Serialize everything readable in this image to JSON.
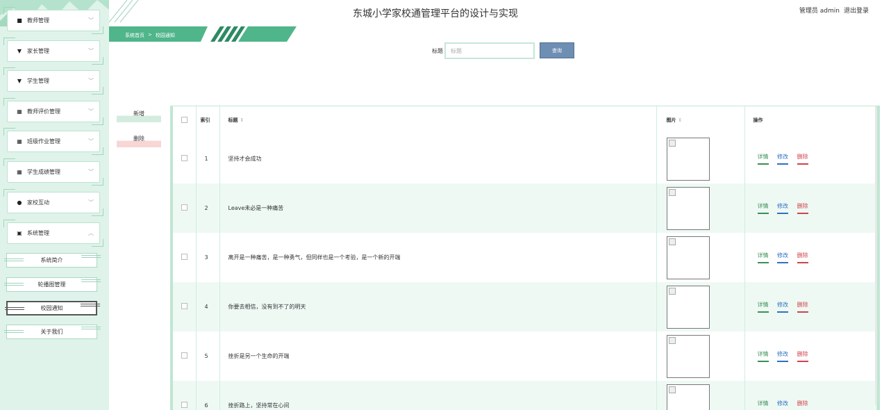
{
  "app": {
    "title": "东城小学家校通管理平台的设计与实现"
  },
  "user": {
    "label": "管理员 admin",
    "logout": "退出登录"
  },
  "breadcrumb": {
    "home": "系统首页",
    "sep": ">",
    "current": "校园通知"
  },
  "sidebar": {
    "groups": [
      {
        "label": "教师管理",
        "icon": "teacher-icon",
        "expanded": false
      },
      {
        "label": "家长管理",
        "icon": "parent-icon",
        "expanded": false
      },
      {
        "label": "学生管理",
        "icon": "student-icon",
        "expanded": false
      },
      {
        "label": "教师评价管理",
        "icon": "grid-icon",
        "expanded": false
      },
      {
        "label": "班级作业管理",
        "icon": "grid-icon",
        "expanded": false
      },
      {
        "label": "学生成绩管理",
        "icon": "grid-icon",
        "expanded": false
      },
      {
        "label": "家校互动",
        "icon": "pin-icon",
        "expanded": false
      },
      {
        "label": "系统管理",
        "icon": "building-icon",
        "expanded": true
      }
    ],
    "submenu": [
      {
        "label": "系统简介",
        "active": false
      },
      {
        "label": "轮播图管理",
        "active": false
      },
      {
        "label": "校园通知",
        "active": true
      },
      {
        "label": "关于我们",
        "active": false
      }
    ]
  },
  "search": {
    "label": "标题",
    "placeholder": "标题",
    "value": "",
    "button": "查询"
  },
  "actions": {
    "add": "新增",
    "delete": "删除"
  },
  "table": {
    "columns": {
      "index": "索引",
      "title": "标题",
      "image": "图片",
      "ops": "操作"
    },
    "sort_icon": "⇕",
    "rows": [
      {
        "index": "1",
        "title": "坚持才会成功"
      },
      {
        "index": "2",
        "title": "Leave未必是一种痛苦"
      },
      {
        "index": "3",
        "title": "离开是一种痛苦，是一种勇气，但同样也是一个考验，是一个新的开端"
      },
      {
        "index": "4",
        "title": "你要去相信，没有到不了的明天"
      },
      {
        "index": "5",
        "title": "挫折是另一个生命的开端"
      },
      {
        "index": "6",
        "title": "挫折路上，坚持常在心间"
      }
    ],
    "row_actions": {
      "detail": "详情",
      "edit": "修改",
      "delete": "删除"
    }
  },
  "colors": {
    "accent": "#4fb58a",
    "sidebar_bg": "#dff3ea",
    "search_button": "#6e8fb3",
    "detail": "#3a8f55",
    "edit": "#2f6fc0",
    "delete": "#d0424b"
  }
}
